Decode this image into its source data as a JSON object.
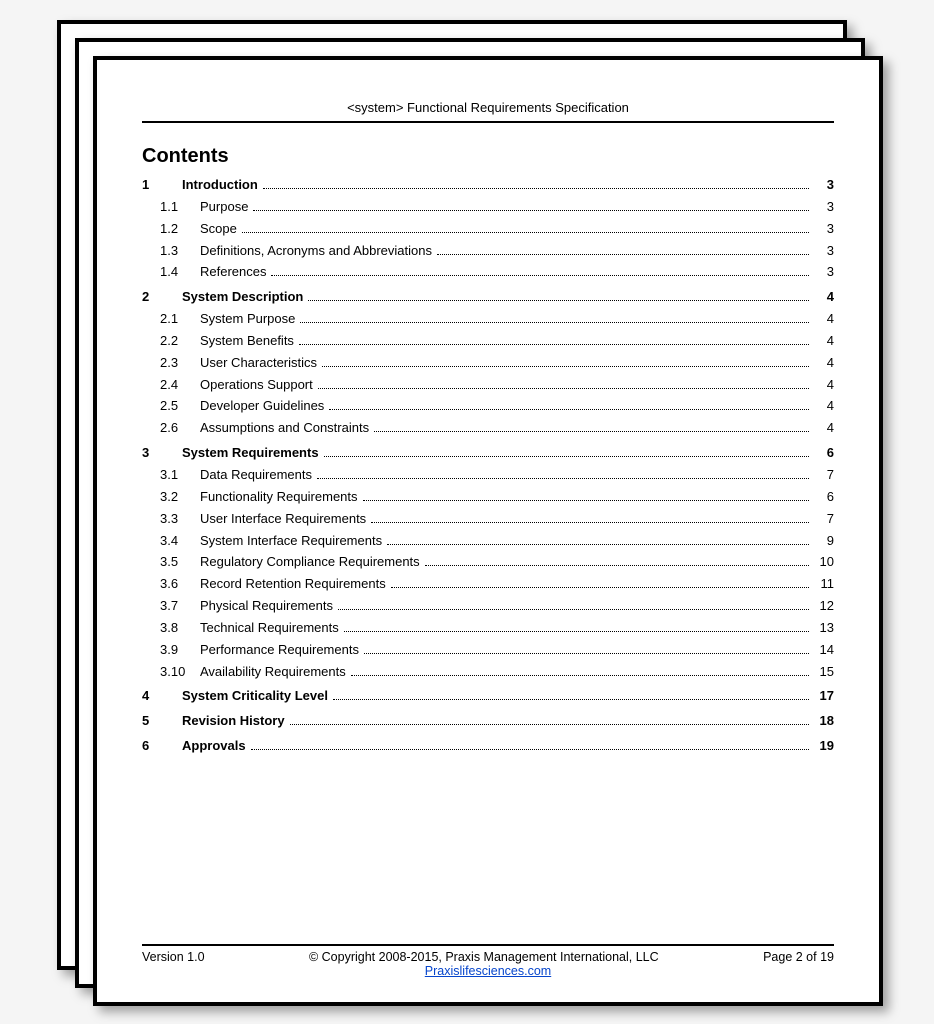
{
  "header": {
    "title": "<system> Functional Requirements Specification"
  },
  "contents_heading": "Contents",
  "toc": [
    {
      "num": "1",
      "title": "Introduction",
      "page": "3",
      "level": 1
    },
    {
      "num": "1.1",
      "title": "Purpose",
      "page": "3",
      "level": 2
    },
    {
      "num": "1.2",
      "title": "Scope",
      "page": "3",
      "level": 2
    },
    {
      "num": "1.3",
      "title": "Definitions, Acronyms and Abbreviations",
      "page": "3",
      "level": 2
    },
    {
      "num": "1.4",
      "title": "References",
      "page": "3",
      "level": 2
    },
    {
      "num": "2",
      "title": "System Description",
      "page": "4",
      "level": 1
    },
    {
      "num": "2.1",
      "title": "System Purpose",
      "page": "4",
      "level": 2
    },
    {
      "num": "2.2",
      "title": "System Benefits",
      "page": "4",
      "level": 2
    },
    {
      "num": "2.3",
      "title": "User Characteristics",
      "page": "4",
      "level": 2
    },
    {
      "num": "2.4",
      "title": "Operations Support",
      "page": "4",
      "level": 2
    },
    {
      "num": "2.5",
      "title": "Developer Guidelines",
      "page": "4",
      "level": 2
    },
    {
      "num": "2.6",
      "title": "Assumptions and Constraints",
      "page": "4",
      "level": 2
    },
    {
      "num": "3",
      "title": "System Requirements",
      "page": "6",
      "level": 1
    },
    {
      "num": "3.1",
      "title": "Data Requirements",
      "page": "7",
      "level": 2
    },
    {
      "num": "3.2",
      "title": "Functionality Requirements",
      "page": "6",
      "level": 2
    },
    {
      "num": "3.3",
      "title": "User Interface Requirements",
      "page": "7",
      "level": 2
    },
    {
      "num": "3.4",
      "title": "System Interface Requirements",
      "page": "9",
      "level": 2
    },
    {
      "num": "3.5",
      "title": "Regulatory Compliance Requirements",
      "page": "10",
      "level": 2
    },
    {
      "num": "3.6",
      "title": "Record Retention Requirements",
      "page": "11",
      "level": 2
    },
    {
      "num": "3.7",
      "title": "Physical Requirements",
      "page": "12",
      "level": 2
    },
    {
      "num": "3.8",
      "title": "Technical Requirements",
      "page": "13",
      "level": 2
    },
    {
      "num": "3.9",
      "title": "Performance Requirements",
      "page": "14",
      "level": 2
    },
    {
      "num": "3.10",
      "title": "Availability Requirements",
      "page": "15",
      "level": 2
    },
    {
      "num": "4",
      "title": "System Criticality Level",
      "page": "17",
      "level": 1
    },
    {
      "num": "5",
      "title": "Revision History",
      "page": "18",
      "level": 1
    },
    {
      "num": "6",
      "title": "Approvals",
      "page": "19",
      "level": 1
    }
  ],
  "footer": {
    "version": "Version 1.0",
    "copyright": "© Copyright 2008-2015, Praxis Management International, LLC",
    "page_label": "Page 2 of 19",
    "link_text": "Praxislifesciences.com"
  }
}
